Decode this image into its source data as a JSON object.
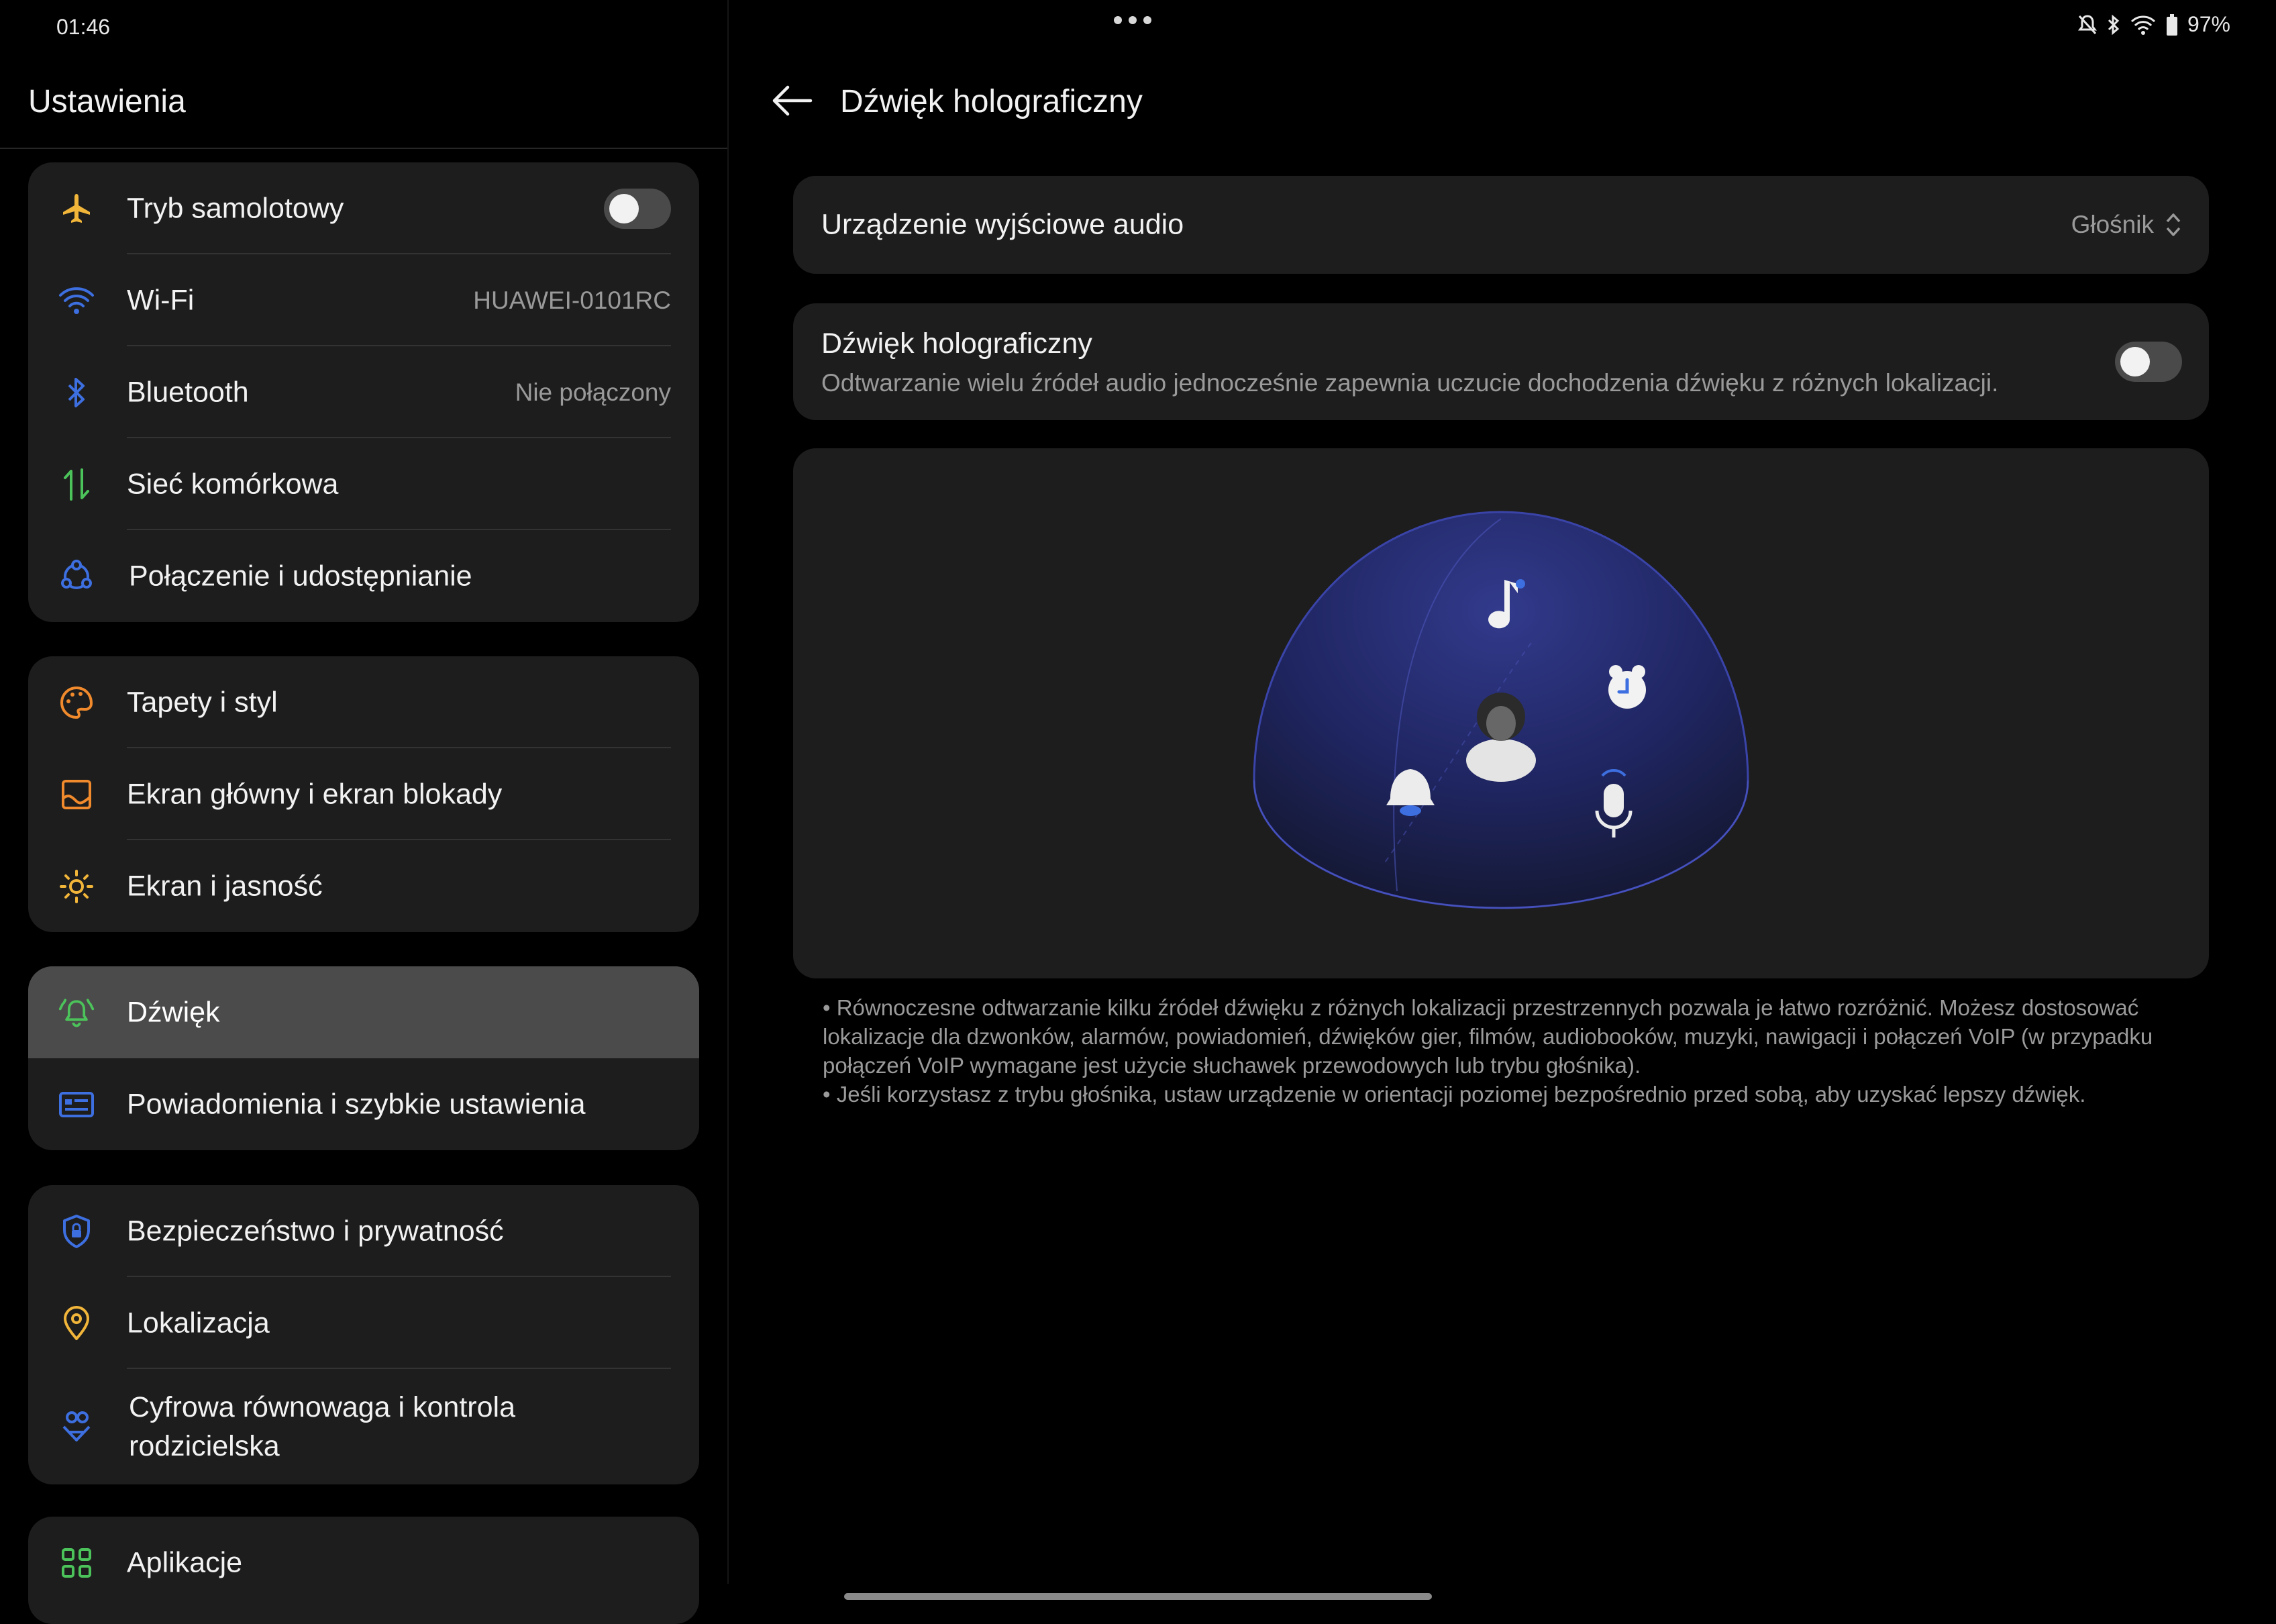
{
  "status": {
    "time": "01:46",
    "battery": "97%"
  },
  "settings": {
    "title": "Ustawienia",
    "groups": [
      {
        "items": [
          {
            "label": "Tryb samolotowy",
            "icon": "airplane-icon",
            "toggle": false
          },
          {
            "label": "Wi-Fi",
            "icon": "wifi-icon",
            "value": "HUAWEI-0101RC"
          },
          {
            "label": "Bluetooth",
            "icon": "bluetooth-icon",
            "value": "Nie połączony"
          },
          {
            "label": "Sieć komórkowa",
            "icon": "mobile-data-icon"
          },
          {
            "label": "Połączenie i udostępnianie",
            "icon": "connection-sharing-icon"
          }
        ]
      },
      {
        "items": [
          {
            "label": "Tapety i styl",
            "icon": "palette-icon"
          },
          {
            "label": "Ekran główny i ekran blokady",
            "icon": "home-lock-screen-icon"
          },
          {
            "label": "Ekran i jasność",
            "icon": "brightness-icon"
          }
        ]
      },
      {
        "items": [
          {
            "label": "Dźwięk",
            "icon": "sound-bell-icon",
            "selected": true
          },
          {
            "label": "Powiadomienia i szybkie ustawienia",
            "icon": "notifications-icon"
          }
        ]
      },
      {
        "items": [
          {
            "label": "Bezpieczeństwo i prywatność",
            "icon": "shield-icon"
          },
          {
            "label": "Lokalizacja",
            "icon": "location-pin-icon"
          },
          {
            "label": "Cyfrowa równowaga i kontrola rodzicielska",
            "icon": "digital-wellbeing-icon"
          }
        ]
      },
      {
        "items": [
          {
            "label": "Aplikacje",
            "icon": "apps-grid-icon"
          }
        ]
      }
    ]
  },
  "detail": {
    "title": "Dźwięk holograficzny",
    "output": {
      "label": "Urządzenie wyjściowe audio",
      "value": "Głośnik"
    },
    "holo": {
      "title": "Dźwięk holograficzny",
      "subtitle": "Odtwarzanie wielu źródeł audio jednocześnie zapewnia uczucie dochodzenia dźwięku z różnych lokalizacji.",
      "toggle": false
    },
    "info": [
      "• Równoczesne odtwarzanie kilku źródeł dźwięku z różnych lokalizacji przestrzennych pozwala je łatwo rozróżnić. Możesz dostosować lokalizacje dla dzwonków, alarmów, powiadomień, dźwięków gier, filmów, audiobooków, muzyki, nawigacji i połączeń VoIP (w przypadku połączeń VoIP wymagane jest użycie słuchawek przewodowych lub trybu głośnika).",
      "• Jeśli korzystasz z trybu głośnika, ustaw urządzenie w orientacji poziomej bezpośrednio przed sobą, aby uzyskać lepszy dźwięk."
    ]
  },
  "colors": {
    "accent_blue": "#3d6fe0",
    "accent_orange": "#f08a2c",
    "accent_green": "#4cc35a",
    "accent_yellow": "#f1b53a"
  }
}
